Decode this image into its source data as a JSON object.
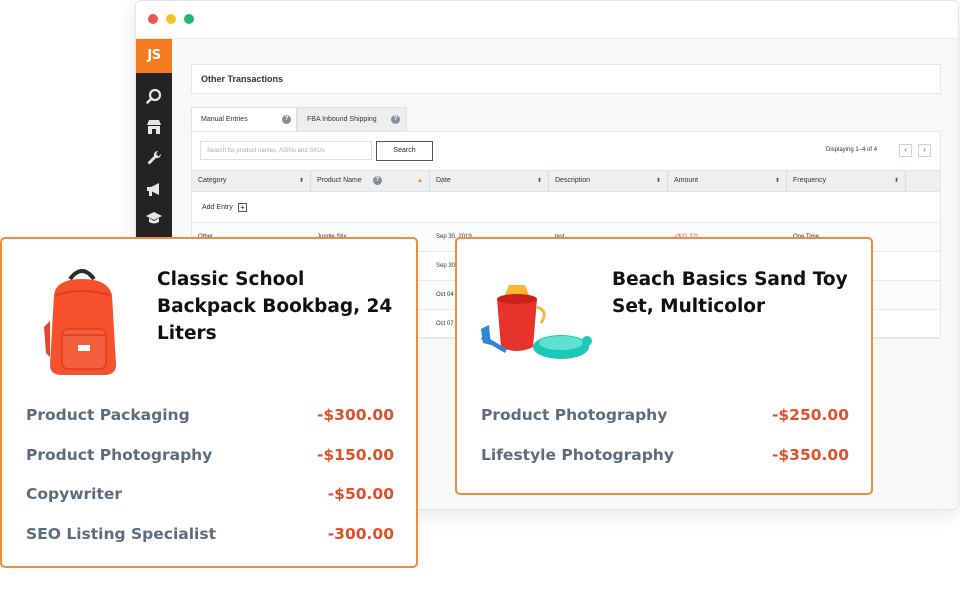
{
  "app": {
    "logo": "JS"
  },
  "page": {
    "title": "Other Transactions"
  },
  "tabs": [
    {
      "label": "Manual Entries",
      "help": "?"
    },
    {
      "label": "FBA Inbound Shipping",
      "help": "?"
    }
  ],
  "search": {
    "placeholder": "Search for product names, ASINs and SKUs",
    "button": "Search"
  },
  "pagination": {
    "displaying": "Displaying  1–4  of 4",
    "prev": "‹",
    "next": "›"
  },
  "table": {
    "columns": [
      {
        "label": "Category",
        "sort": "⬍"
      },
      {
        "label": "Product Name",
        "sort": "▲",
        "help": "?"
      },
      {
        "label": "Date",
        "sort": "⬍"
      },
      {
        "label": "Description",
        "sort": "⬍"
      },
      {
        "label": "Amount",
        "sort": "⬍"
      },
      {
        "label": "Frequency",
        "sort": "⬍"
      }
    ],
    "add_entry": "Add Entry",
    "add_entry_icon": "+",
    "rows": [
      {
        "category": "Other",
        "product": "Jungle Stix",
        "date": "Sep 30, 2019",
        "description": "test",
        "amount": "-($11.22)",
        "frequency": "One Time"
      },
      {
        "date": "Sep 30"
      },
      {
        "date": "Oct 04"
      },
      {
        "date": "Oct 07"
      }
    ]
  },
  "cards": [
    {
      "title": "Classic School Backpack Bookbag, 24 Liters",
      "image": "orange-backpack",
      "items": [
        {
          "name": "Product Packaging",
          "amount": "-$300.00"
        },
        {
          "name": "Product Photography",
          "amount": "-$150.00"
        },
        {
          "name": "Copywriter",
          "amount": "-$50.00"
        },
        {
          "name": "SEO Listing Specialist",
          "amount": "-300.00"
        }
      ]
    },
    {
      "title": "Beach Basics Sand Toy Set, Multicolor",
      "image": "sand-toy-set",
      "items": [
        {
          "name": "Product Photography",
          "amount": "-$250.00"
        },
        {
          "name": "Lifestyle Photography",
          "amount": "-$350.00"
        }
      ]
    }
  ],
  "icons": [
    "search-icon",
    "storefront-icon",
    "wrench-icon",
    "megaphone-icon",
    "graduation-cap-icon"
  ],
  "colors": {
    "accent": "#f47b20",
    "card_border": "#f28c3a",
    "negative": "#e0502c",
    "sidebar": "#232323"
  }
}
